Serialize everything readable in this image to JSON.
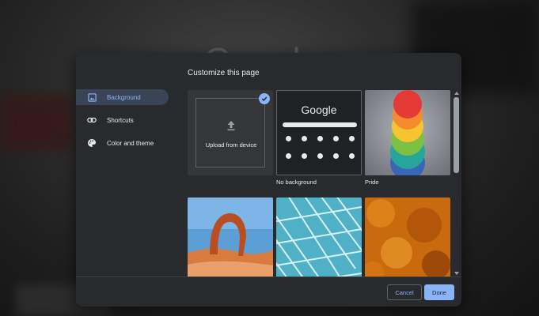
{
  "background_page": {
    "logo_text": "Google"
  },
  "dialog": {
    "title": "Customize this page",
    "nav": [
      {
        "label": "Background",
        "icon": "image-icon",
        "active": true
      },
      {
        "label": "Shortcuts",
        "icon": "link-icon",
        "active": false
      },
      {
        "label": "Color and theme",
        "icon": "palette-icon",
        "active": false
      }
    ],
    "tiles": {
      "upload": {
        "label": "Upload from device",
        "selected": true
      },
      "no_background": {
        "label": "No background",
        "preview_logo": "Google"
      },
      "pride": {
        "label": "Pride"
      }
    },
    "buttons": {
      "cancel": "Cancel",
      "done": "Done"
    }
  },
  "colors": {
    "accent": "#8ab4f8",
    "dialog_bg": "#292a2d",
    "text": "#e8eaed"
  }
}
